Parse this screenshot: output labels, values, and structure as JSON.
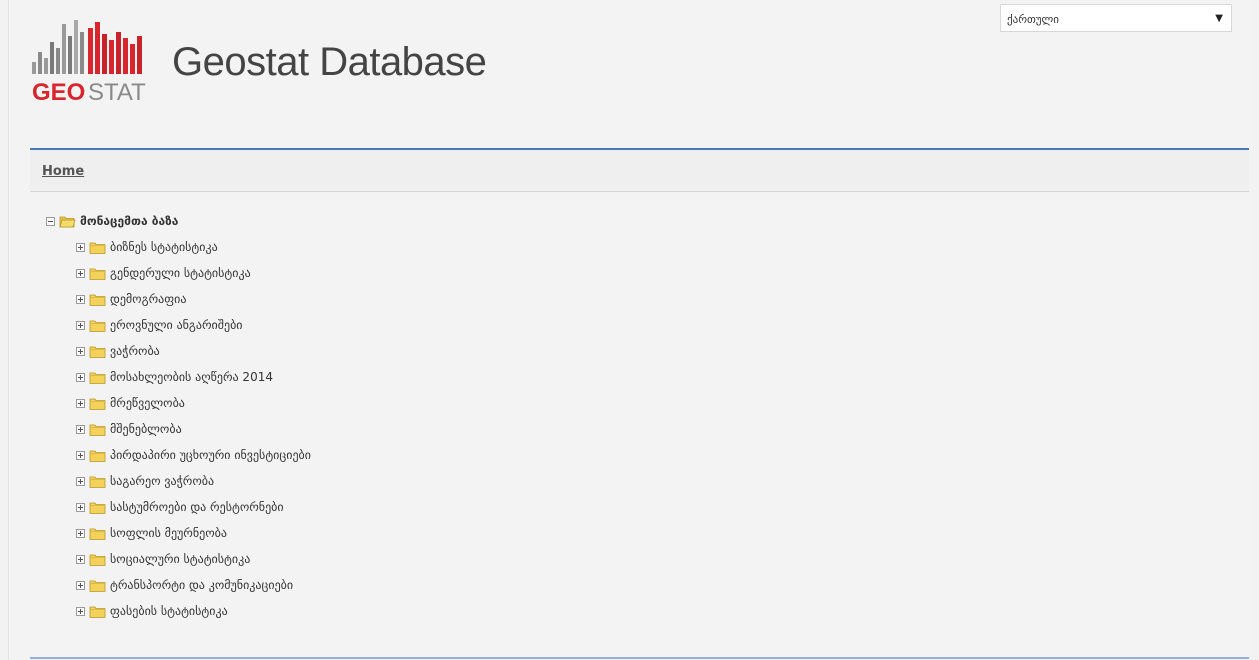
{
  "header": {
    "app_title": "Geostat Database",
    "logo_text_geo": "GEO",
    "logo_text_stat": "STAT",
    "language_select": "ქართული"
  },
  "breadcrumb": {
    "home_label": "Home"
  },
  "tree": {
    "root": "მონაცემთა ბაზა",
    "items": [
      "ბიზნეს სტატისტიკა",
      "გენდერული სტატისტიკა",
      "დემოგრაფია",
      "ეროვნული ანგარიშები",
      "ვაჭრობა",
      "მოსახლეობის აღწერა 2014",
      "მრეწველობა",
      "მშენებლობა",
      "პირდაპირი უცხოური ინვესტიციები",
      "საგარეო ვაჭრობა",
      "სასტუმროები და რესტორნები",
      "სოფლის მეურნეობა",
      "სოციალური სტატისტიკა",
      "ტრანსპორტი და კომუნიკაციები",
      "ფასების სტატისტიკა"
    ]
  },
  "colors": {
    "accent_blue": "#4a79b8",
    "logo_red": "#d7262e",
    "logo_gray": "#8a8a8a",
    "folder_yellow": "#f3d15a"
  }
}
